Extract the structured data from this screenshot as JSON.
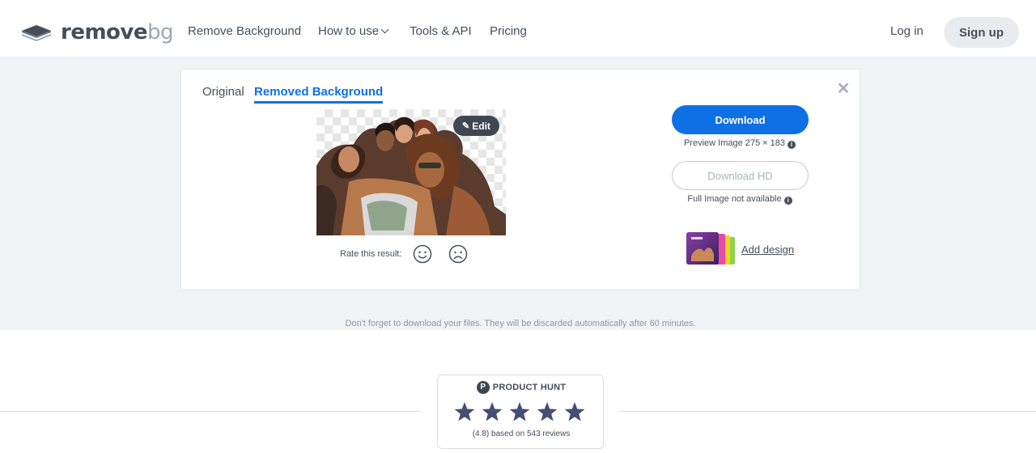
{
  "brand": {
    "name_main": "remove",
    "name_suffix": "bg"
  },
  "nav": {
    "items": [
      {
        "label": "Remove Background",
        "has_dropdown": false
      },
      {
        "label": "How to use",
        "has_dropdown": true
      },
      {
        "label": "Tools & API",
        "has_dropdown": false
      },
      {
        "label": "Pricing",
        "has_dropdown": false
      }
    ],
    "login_label": "Log in",
    "signup_label": "Sign up"
  },
  "result": {
    "tabs": [
      {
        "label": "Original",
        "active": false
      },
      {
        "label": "Removed Background",
        "active": true
      }
    ],
    "close_icon": "close-icon",
    "edit_label": "Edit",
    "rate_label": "Rate this result:",
    "download_label": "Download",
    "preview_info": "Preview Image 275 × 183",
    "download_hd_label": "Download HD",
    "full_info": "Full Image not available",
    "add_design_label": "Add design"
  },
  "discard_note": "Don't forget to download your files. They will be discarded automatically after 60 minutes.",
  "product_hunt": {
    "title": "PRODUCT HUNT",
    "logo_letter": "P",
    "rating": 5,
    "reviews_text": "(4.8) based on 543 reviews"
  },
  "colors": {
    "accent": "#0f70e6",
    "text": "#454f5b",
    "band": "#f1f3f5",
    "star": "#454f73"
  }
}
